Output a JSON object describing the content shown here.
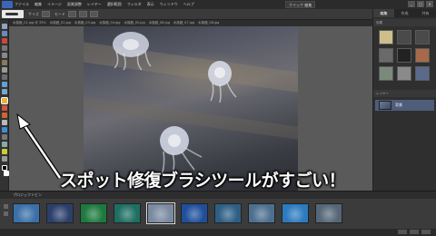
{
  "menubar": {
    "items": [
      "ファイル",
      "編集",
      "イメージ",
      "画質調整",
      "レイヤー",
      "選択範囲",
      "フィルタ",
      "表示",
      "ウィンドウ",
      "ヘルプ"
    ],
    "edit_mode": "クイック 編集",
    "window_buttons": [
      "_",
      "□",
      "×"
    ]
  },
  "optbar": {
    "label_size": "サイズ",
    "label_mode": "モード"
  },
  "tabs": [
    "水族館_01.jpg @ 33%",
    "水族館_02.jpg",
    "水族館_03.jpg",
    "水族館_04.jpg",
    "水族館_05.jpg",
    "水族館_06.jpg",
    "水族館_07.jpg",
    "水族館_08.jpg"
  ],
  "right_panel": {
    "tabs": [
      "編集",
      "作成",
      "共有"
    ],
    "section_effects": "効果",
    "section_layers": "レイヤー",
    "layer_name": "背景"
  },
  "bin": {
    "title": "プロジェクトビン",
    "thumb_colors": [
      "#3a6fa8",
      "#2c3f6a",
      "#1d7a3f",
      "#1e6f62",
      "#7a8aa0",
      "#1f4f9a",
      "#2d5f85",
      "#4d6f8f",
      "#2c7abf",
      "#556677"
    ]
  },
  "annotation": {
    "text": "スポット修復ブラシツールがすごい！"
  },
  "colors": {
    "accent": "#3a66b8",
    "selected_layer": "#4e5d7a"
  }
}
